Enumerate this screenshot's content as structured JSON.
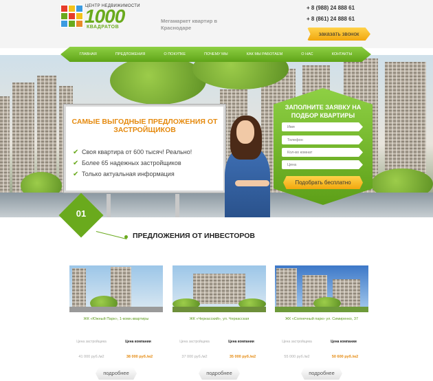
{
  "header": {
    "logo_small": "ЦЕНТР НЕДВИЖИМОСТИ",
    "logo_number": "1000",
    "logo_sub": "КВАДРАТОВ",
    "tagline": "Мегамаркет квартир в Краснодаре",
    "phone_1": "+ 8 (988) 24 888 61",
    "phone_2": "+ 8 (861) 24 888 61",
    "call_button": "заказать звонок"
  },
  "nav": {
    "items": [
      "ГЛАВНАЯ",
      "ПРЕДЛОЖЕНИЯ",
      "О ПОКУПКЕ",
      "ПОЧЕМУ МЫ",
      "КАК МЫ РАБОТАЕМ",
      "О НАС",
      "КОНТАКТЫ"
    ]
  },
  "hero": {
    "billboard_title": "САМЫЕ ВЫГОДНЫЕ ПРЕДЛОЖЕНИЯ ОТ ЗАСТРОЙЩИКОВ",
    "bullets": [
      "Своя квартира от 600 тысяч! Реально!",
      "Более 65 надежных застройщиков",
      "Только актуальная информация"
    ],
    "form_title": "ЗАПОЛНИТЕ ЗАЯВКУ НА ПОДБОР КВАРТИРЫ",
    "form_placeholders": [
      "Имя",
      "Телефон",
      "Кол-во комнат",
      "Цена"
    ],
    "form_button": "Подобрать бесплатно"
  },
  "section": {
    "number": "01",
    "title": "ПРЕДЛОЖЕНИЯ ОТ ИНВЕСТОРОВ"
  },
  "cards": [
    {
      "title": "ЖК «Южный Парк», 1-комн.квартиры",
      "label_left": "Цена застройщика",
      "label_right": "Цена компании",
      "price_left": "41 000 руб./м2",
      "price_right": "38 000 руб./м2",
      "button": "подробнее"
    },
    {
      "title": "ЖК «Черкасский», ул. Черкасская",
      "label_left": "Цена застройщика",
      "label_right": "Цена компании",
      "price_left": "37 000 руб./м2",
      "price_right": "35 000 руб./м2",
      "button": "подробнее"
    },
    {
      "title": "ЖК «Солнечный парк» ул. Симиренко, 37",
      "label_left": "Цена застройщика",
      "label_right": "Цена компании",
      "price_left": "55 000 руб./м2",
      "price_right": "50 600 руб./м2",
      "button": "подробнее"
    }
  ],
  "colors": {
    "brand_green": "#6aaa1d",
    "accent_orange": "#e58a0f",
    "button_yellow": "#f5b51e"
  }
}
